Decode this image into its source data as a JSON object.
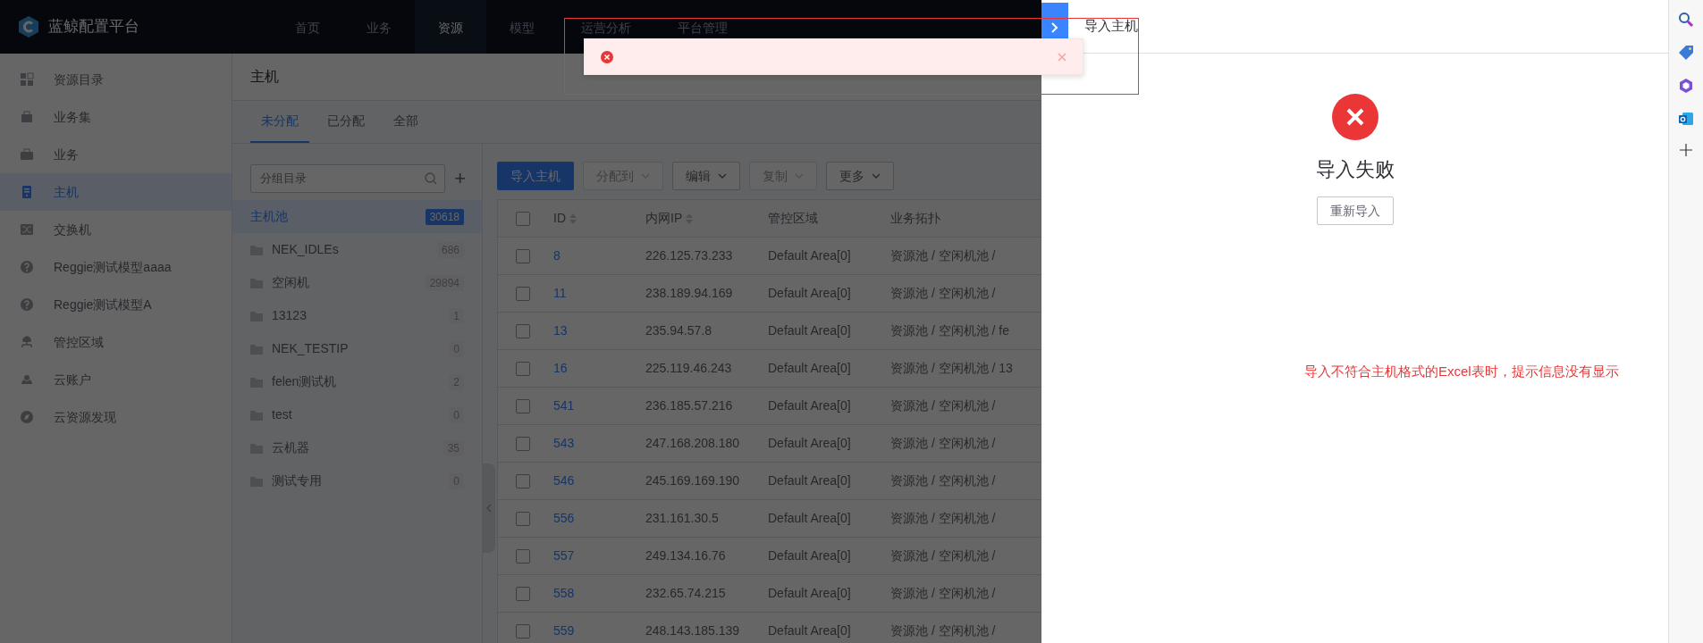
{
  "app": {
    "title": "蓝鲸配置平台"
  },
  "top_nav": [
    {
      "label": "首页",
      "selected": false
    },
    {
      "label": "业务",
      "selected": false
    },
    {
      "label": "资源",
      "selected": true
    },
    {
      "label": "模型",
      "selected": false
    },
    {
      "label": "运营分析",
      "selected": false
    },
    {
      "label": "平台管理",
      "selected": false
    }
  ],
  "sidebar": {
    "items": [
      {
        "label": "资源目录",
        "selected": false
      },
      {
        "label": "业务集",
        "selected": false
      },
      {
        "label": "业务",
        "selected": false
      },
      {
        "label": "主机",
        "selected": true
      },
      {
        "label": "交换机",
        "selected": false
      },
      {
        "label": "Reggie测试模型aaaa",
        "selected": false
      },
      {
        "label": "Reggie测试模型A",
        "selected": false
      },
      {
        "label": "管控区域",
        "selected": false
      },
      {
        "label": "云账户",
        "selected": false
      },
      {
        "label": "云资源发现",
        "selected": false
      }
    ]
  },
  "page": {
    "title": "主机"
  },
  "tabs": [
    {
      "label": "未分配",
      "selected": true
    },
    {
      "label": "已分配",
      "selected": false
    },
    {
      "label": "全部",
      "selected": false
    }
  ],
  "group_panel": {
    "search": {
      "placeholder": "分组目录"
    },
    "add": "+",
    "groups": [
      {
        "kind": "root",
        "label": "主机池",
        "count": "30618",
        "selected": true
      },
      {
        "kind": "folder",
        "label": "NEK_IDLEs",
        "count": "686",
        "selected": false
      },
      {
        "kind": "folder",
        "label": "空闲机",
        "count": "29894",
        "selected": false
      },
      {
        "kind": "folder",
        "label": "13123",
        "count": "1",
        "selected": false
      },
      {
        "kind": "folder",
        "label": "NEK_TESTIP",
        "count": "0",
        "selected": false
      },
      {
        "kind": "folder",
        "label": "felen测试机",
        "count": "2",
        "selected": false
      },
      {
        "kind": "folder",
        "label": "test",
        "count": "0",
        "selected": false
      },
      {
        "kind": "folder",
        "label": "云机器",
        "count": "35",
        "selected": false
      },
      {
        "kind": "folder",
        "label": "测试专用",
        "count": "0",
        "selected": false
      }
    ]
  },
  "toolbar": {
    "buttons": [
      {
        "label": "导入主机",
        "kind": "primary",
        "disabled": false,
        "dropdown": false
      },
      {
        "label": "分配到",
        "kind": "default",
        "disabled": true,
        "dropdown": true
      },
      {
        "label": "编辑",
        "kind": "default",
        "disabled": false,
        "dropdown": true
      },
      {
        "label": "复制",
        "kind": "default",
        "disabled": true,
        "dropdown": true
      },
      {
        "label": "更多",
        "kind": "default",
        "disabled": false,
        "dropdown": true
      }
    ]
  },
  "table": {
    "header_checked": false,
    "columns": [
      {
        "label": "ID",
        "sortable": true
      },
      {
        "label": "内网IP",
        "sortable": true
      },
      {
        "label": "管控区域",
        "sortable": false
      },
      {
        "label": "业务拓扑",
        "sortable": false
      }
    ],
    "rows": [
      {
        "id": "8",
        "ip": "226.125.73.233",
        "area": "Default Area[0]",
        "topology": "资源池 / 空闲机池 /",
        "checked": false
      },
      {
        "id": "11",
        "ip": "238.189.94.169",
        "area": "Default Area[0]",
        "topology": "资源池 / 空闲机池 /",
        "checked": false
      },
      {
        "id": "13",
        "ip": "235.94.57.8",
        "area": "Default Area[0]",
        "topology": "资源池 / 空闲机池 / fe",
        "checked": false
      },
      {
        "id": "16",
        "ip": "225.119.46.243",
        "area": "Default Area[0]",
        "topology": "资源池 / 空闲机池 / 13",
        "checked": false
      },
      {
        "id": "541",
        "ip": "236.185.57.216",
        "area": "Default Area[0]",
        "topology": "资源池 / 空闲机池 /",
        "checked": false
      },
      {
        "id": "543",
        "ip": "247.168.208.180",
        "area": "Default Area[0]",
        "topology": "资源池 / 空闲机池 /",
        "checked": false
      },
      {
        "id": "546",
        "ip": "245.169.169.190",
        "area": "Default Area[0]",
        "topology": "资源池 / 空闲机池 /",
        "checked": false
      },
      {
        "id": "556",
        "ip": "231.161.30.5",
        "area": "Default Area[0]",
        "topology": "资源池 / 空闲机池 /",
        "checked": false
      },
      {
        "id": "557",
        "ip": "249.134.16.76",
        "area": "Default Area[0]",
        "topology": "资源池 / 空闲机池 /",
        "checked": false
      },
      {
        "id": "558",
        "ip": "232.65.74.215",
        "area": "Default Area[0]",
        "topology": "资源池 / 空闲机池 /",
        "checked": false
      },
      {
        "id": "559",
        "ip": "248.143.185.139",
        "area": "Default Area[0]",
        "topology": "资源池 / 空闲机池 /",
        "checked": false
      }
    ]
  },
  "drawer": {
    "title": "导入主机",
    "result": {
      "kind": "error",
      "title": "导入失败"
    },
    "buttons": [
      "重新导入"
    ]
  },
  "toast": {
    "kind": "error"
  },
  "annotation": {
    "text": "导入不符合主机格式的Excel表时，提示信息没有显示"
  }
}
